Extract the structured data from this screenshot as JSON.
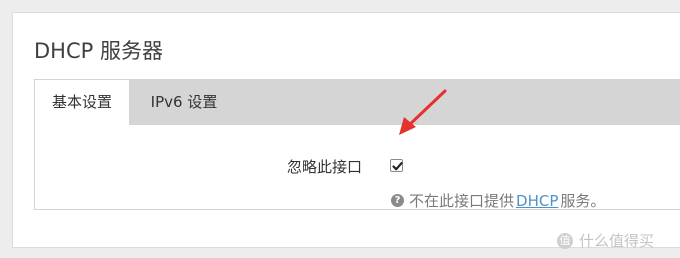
{
  "panel": {
    "title": "DHCP 服务器"
  },
  "tabs": [
    {
      "label": "基本设置",
      "active": true
    },
    {
      "label": "IPv6 设置",
      "active": false
    }
  ],
  "ignore_interface": {
    "label": "忽略此接口",
    "checked": true
  },
  "help": {
    "icon": "question-circle-icon",
    "text_before": "不在此接口提供",
    "link": "DHCP",
    "text_after": "服务。"
  },
  "annotation": {
    "arrow_color": "#e5322d"
  },
  "watermark": {
    "logo": "值",
    "text": "什么值得买"
  }
}
